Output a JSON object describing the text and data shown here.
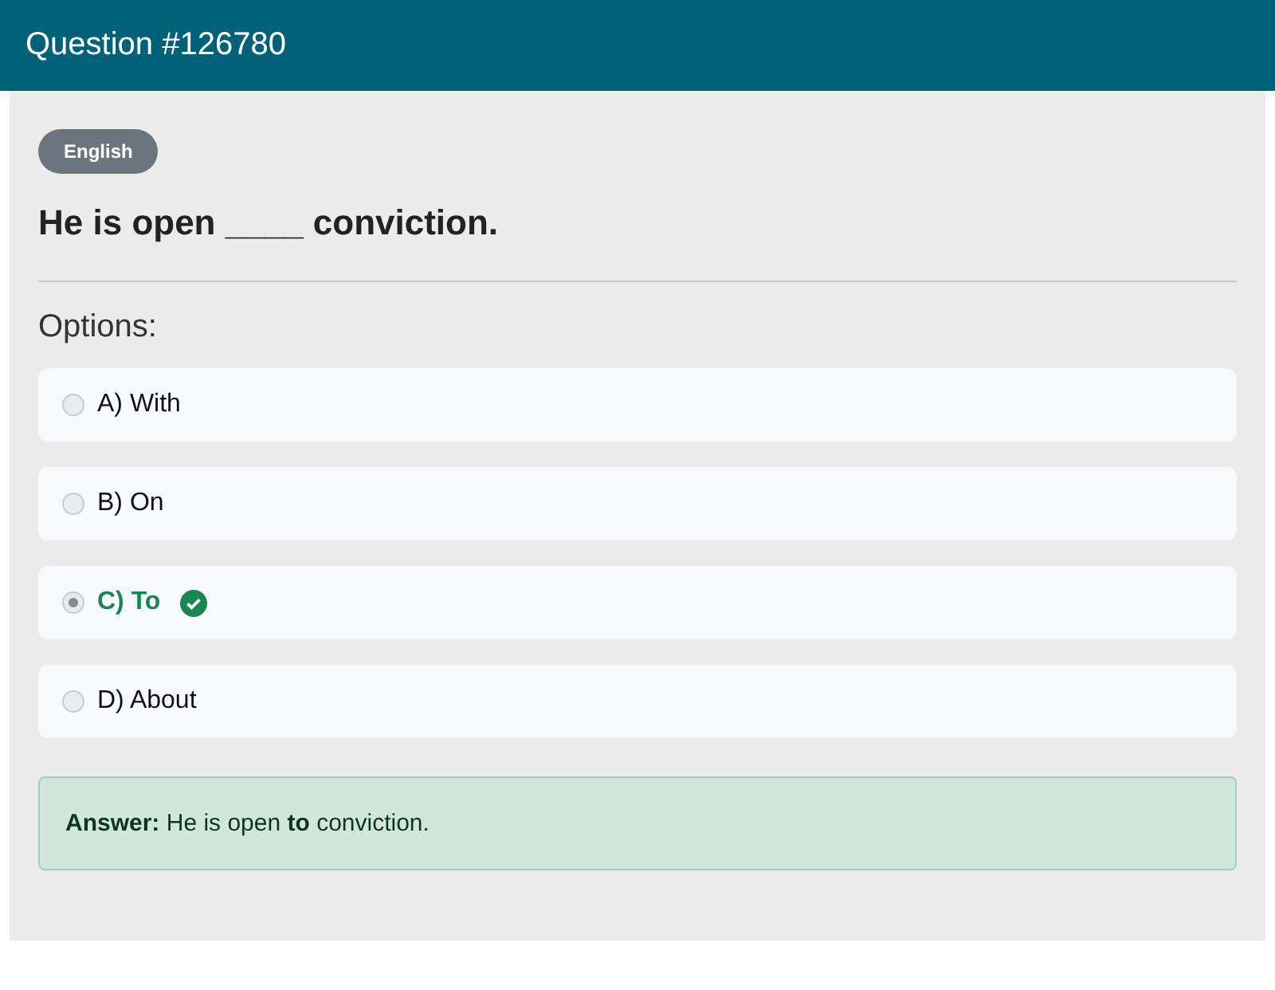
{
  "header": {
    "title": "Question #126780"
  },
  "language_badge": "English",
  "question": "He is open ____ conviction.",
  "options_label": "Options:",
  "options": [
    {
      "label": "A) With",
      "selected": false,
      "correct": false
    },
    {
      "label": "B) On",
      "selected": false,
      "correct": false
    },
    {
      "label": "C) To",
      "selected": true,
      "correct": true
    },
    {
      "label": "D) About",
      "selected": false,
      "correct": false
    }
  ],
  "answer": "**Answer:** He is open **to** conviction."
}
